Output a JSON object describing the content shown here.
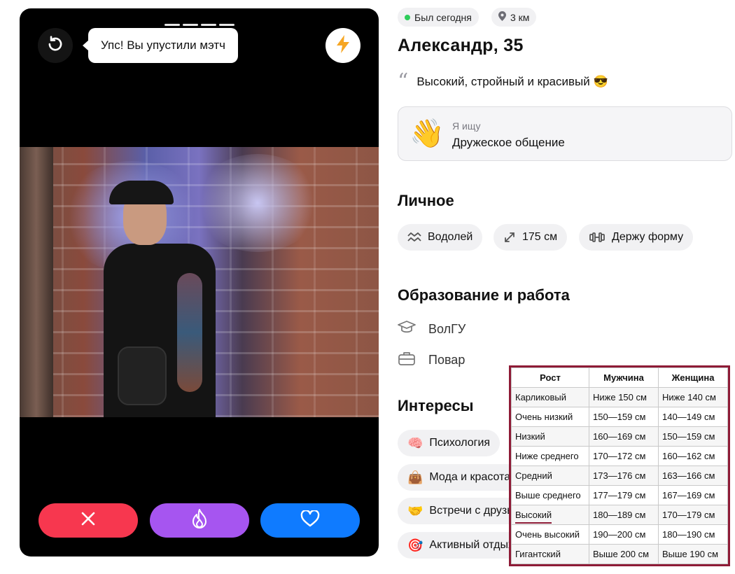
{
  "card": {
    "tooltip": "Упс! Вы упустили мэтч",
    "undo_icon": "undo-icon",
    "boost_icon": "lightning-icon",
    "photo_slides": 4,
    "actions": [
      {
        "name": "dislike",
        "icon": "close-icon",
        "color": "#f7374f"
      },
      {
        "name": "superlike",
        "icon": "flame-icon",
        "color": "#a655f0"
      },
      {
        "name": "like",
        "icon": "heart-icon",
        "color": "#0f7bff"
      }
    ]
  },
  "profile": {
    "status": "Был сегодня",
    "distance": "3 км",
    "name_age": "Александр, 35",
    "bio": "Высокий, стройный и красивый 😎",
    "seeking": {
      "label": "Я ищу",
      "value": "Дружеское общение",
      "emoji": "👋"
    },
    "personal": {
      "title": "Личное",
      "chips": [
        {
          "icon": "aquarius-icon",
          "label": "Водолей"
        },
        {
          "icon": "height-arrows-icon",
          "label": "175 см"
        },
        {
          "icon": "dumbbell-icon",
          "label": "Держу форму"
        }
      ]
    },
    "education": {
      "title": "Образование и работа",
      "items": [
        {
          "icon": "graduation-cap-icon",
          "label": "ВолГУ"
        },
        {
          "icon": "briefcase-icon",
          "label": "Повар"
        }
      ]
    },
    "interests": {
      "title": "Интересы",
      "chips": [
        {
          "emoji": "🧠",
          "label": "Психология"
        },
        {
          "emoji": "👜",
          "label": "Мода и красота"
        },
        {
          "emoji": "🤝",
          "label": "Встречи с друзьями"
        },
        {
          "emoji": "🎯",
          "label": "Активный отдых"
        }
      ]
    }
  },
  "height_table": {
    "headers": [
      "Рост",
      "Мужчина",
      "Женщина"
    ],
    "rows": [
      [
        "Карликовый",
        "Ниже 150 см",
        "Ниже 140 см"
      ],
      [
        "Очень низкий",
        "150—159 см",
        "140—149 см"
      ],
      [
        "Низкий",
        "160—169 см",
        "150—159 см"
      ],
      [
        "Ниже среднего",
        "170—172 см",
        "160—162 см"
      ],
      [
        "Средний",
        "173—176 см",
        "163—166 см"
      ],
      [
        "Выше среднего",
        "177—179 см",
        "167—169 см"
      ],
      [
        "Высокий",
        "180—189 см",
        "170—179 см"
      ],
      [
        "Очень высокий",
        "190—200 см",
        "180—190 см"
      ],
      [
        "Гигантский",
        "Выше 200 см",
        "Выше 190 см"
      ]
    ],
    "highlighted_row": "Высокий",
    "border_color": "#8e1b36"
  }
}
